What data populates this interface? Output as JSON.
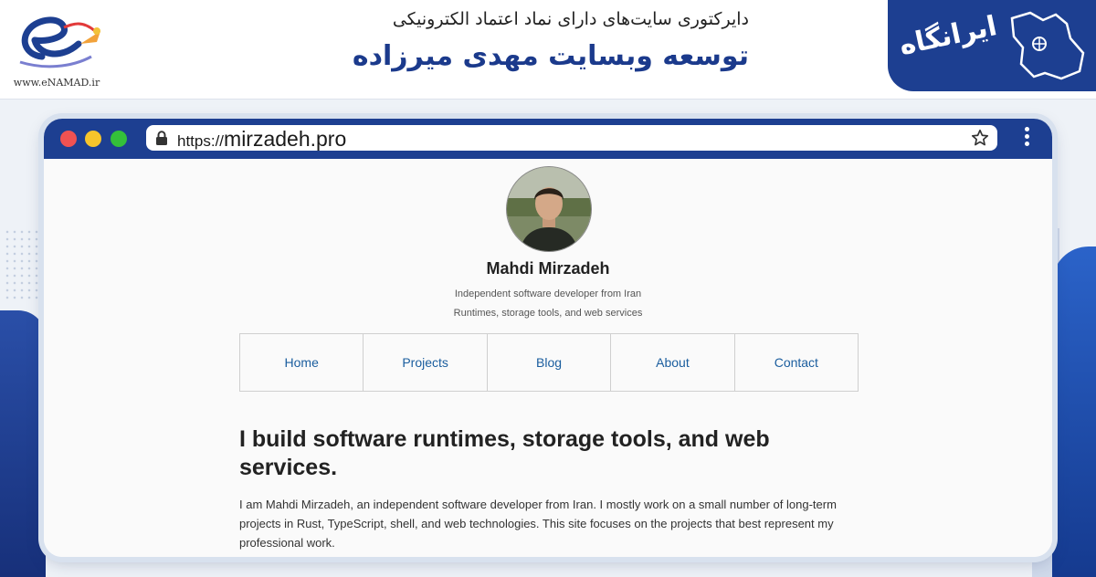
{
  "header": {
    "enamad_text": "www.eNAMAD.ir",
    "subtitle": "دایرکتوری سایت‌های دارای نماد اعتماد الکترونیکی",
    "main_title": "توسعه وبسایت مهدی میرزاده",
    "brand_text": "ایرانگاه"
  },
  "browser": {
    "url_protocol": "https://",
    "url_host": "mirzadeh.pro"
  },
  "profile": {
    "name": "Mahdi Mirzadeh",
    "tagline_1": "Independent software developer from Iran",
    "tagline_2": "Runtimes, storage tools, and web services"
  },
  "nav": {
    "items": [
      {
        "label": "Home"
      },
      {
        "label": "Projects"
      },
      {
        "label": "Blog"
      },
      {
        "label": "About"
      },
      {
        "label": "Contact"
      }
    ]
  },
  "content": {
    "headline": "I build software runtimes, storage tools, and web services.",
    "intro": "I am Mahdi Mirzadeh, an independent software developer from Iran. I mostly work on a small number of long-term projects in Rust, TypeScript, shell, and web technologies. This site focuses on the projects that best represent my professional work."
  },
  "colors": {
    "brand_blue": "#1d3f91",
    "title_blue": "#1b3a8c",
    "link_blue": "#1a5d9e"
  }
}
